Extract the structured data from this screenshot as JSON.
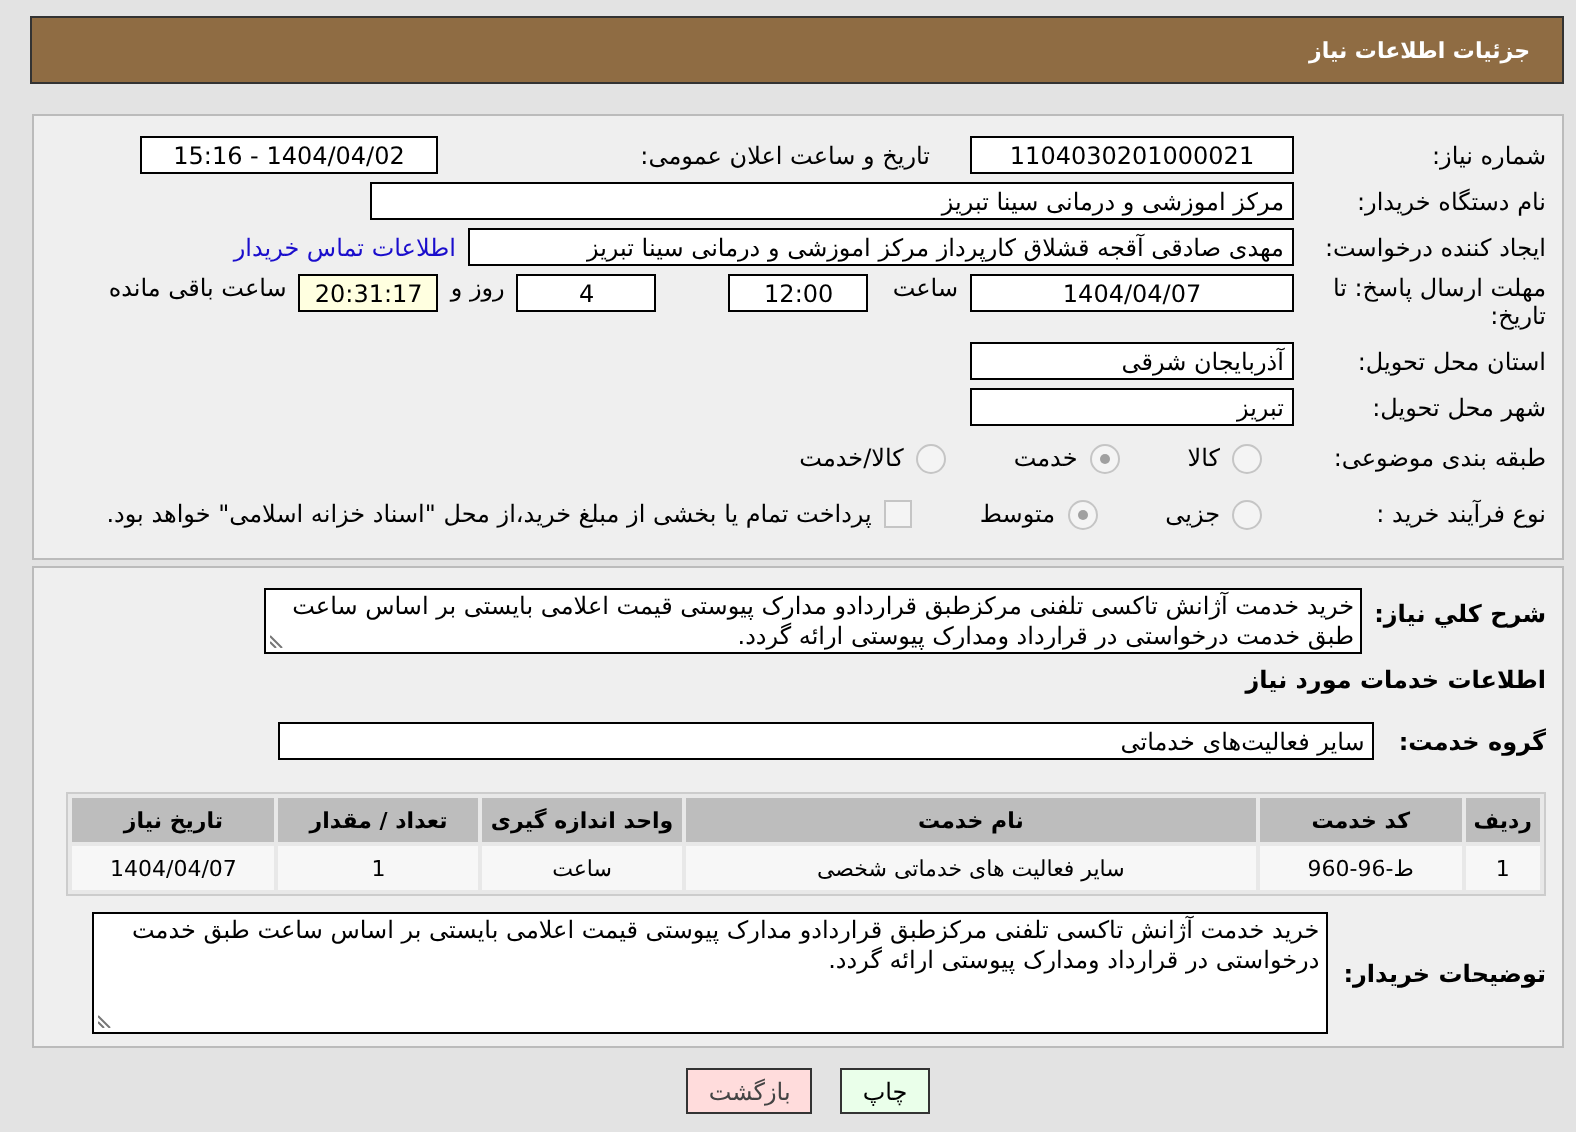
{
  "header": {
    "title": "جزئیات اطلاعات نیاز"
  },
  "need_number": {
    "label": "شماره نیاز:",
    "value": "1104030201000021"
  },
  "announce": {
    "label": "تاریخ و ساعت اعلان عمومی:",
    "value": "1404/04/02 - 15:16"
  },
  "buyer_org": {
    "label": "نام دستگاه خریدار:",
    "value": "مرکز اموزشی و درمانی سینا تبریز"
  },
  "creator": {
    "label": "ایجاد کننده درخواست:",
    "value": "مهدی صادقی آقجه قشلاق کارپرداز مرکز اموزشی و درمانی سینا تبریز",
    "link": "اطلاعات تماس خریدار"
  },
  "deadline": {
    "label": "مهلت ارسال پاسخ: تا تاریخ:",
    "date": "1404/04/07",
    "time_label": "ساعت",
    "time": "12:00",
    "days": "4",
    "days_label": "روز و",
    "remaining": "20:31:17",
    "remaining_label": "ساعت باقی مانده"
  },
  "province": {
    "label": "استان محل تحویل:",
    "value": "آذربایجان شرقی"
  },
  "city": {
    "label": "شهر محل تحویل:",
    "value": "تبریز"
  },
  "category": {
    "label": "طبقه بندی موضوعی:",
    "options": [
      {
        "label": "کالا",
        "selected": false
      },
      {
        "label": "خدمت",
        "selected": true
      },
      {
        "label": "کالا/خدمت",
        "selected": false
      }
    ]
  },
  "process": {
    "label": "نوع فرآیند خرید :",
    "options": [
      {
        "label": "جزیی",
        "selected": false
      },
      {
        "label": "متوسط",
        "selected": true
      }
    ],
    "payment": {
      "checked": false,
      "text": "پرداخت تمام یا بخشی از مبلغ خرید،از محل \"اسناد خزانه اسلامی\" خواهد بود."
    }
  },
  "summary": {
    "label": "شرح کلي نياز:",
    "value": "خرید خدمت آژانش تاکسی تلفنی  مرکزطبق قراردادو مدارک  پیوستی قیمت اعلامی بایستی بر اساس ساعت طبق خدمت درخواستی در قرارداد ومدارک پیوستی ارائه گردد."
  },
  "services_heading": "اطلاعات خدمات مورد نیاز",
  "service_group": {
    "label": "گروه خدمت:",
    "value": "سایر فعالیت‌های خدماتی"
  },
  "table": {
    "columns": [
      "ردیف",
      "کد خدمت",
      "نام خدمت",
      "واحد اندازه گیری",
      "تعداد / مقدار",
      "تاریخ نیاز"
    ],
    "rows": [
      [
        "1",
        "ط-96-960",
        "سایر فعالیت های خدماتی شخصی",
        "ساعت",
        "1",
        "1404/04/07"
      ]
    ]
  },
  "buyer_notes": {
    "label": "توضیحات خریدار:",
    "value": "خرید خدمت آژانش تاکسی تلفنی  مرکزطبق قراردادو مدارک  پیوستی قیمت اعلامی بایستی بر اساس ساعت طبق خدمت درخواستی در قرارداد ومدارک پیوستی ارائه گردد."
  },
  "buttons": [
    {
      "label": "چاپ",
      "kind": "print"
    },
    {
      "label": "بازگشت",
      "kind": "back"
    }
  ]
}
